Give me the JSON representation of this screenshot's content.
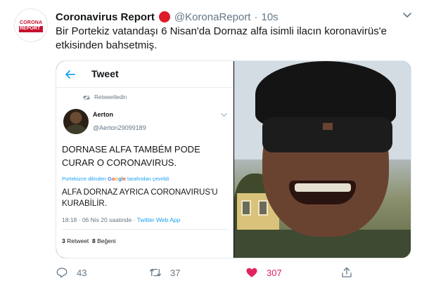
{
  "author": {
    "display_name": "Coronavirus Report",
    "handle": "@KoronaReport",
    "separator": "·",
    "time": "10s",
    "avatar_top": "CORONA",
    "avatar_bottom": "REPORT"
  },
  "tweet_text": "Bir Portekiz vatandaşı 6 Nisan'da Dornaz alfa isimli ilacın koronavirüs'e etkisinden bahsetmiş.",
  "embedded": {
    "header_title": "Tweet",
    "retweeted_label": "Retweetledin",
    "author_name": "Aerton",
    "author_handle": "@Aerton29099189",
    "original_text": "DORNASE ALFA TAMBÉM PODE CURAR O CORONAVIRUS.",
    "translated_prefix": "Portekizce dilinden",
    "translated_service": [
      "G",
      "o",
      "o",
      "g",
      "l",
      "e"
    ],
    "translated_suffix": "tarafından çevrildi",
    "translated_text": "ALFA DORNAZ AYRICA CORONAVIRUS'U KURABİLİR.",
    "time_date": "18:18 · 06 Nis 20 saatinde ·",
    "client": "Twitter Web App",
    "retweets_count": "3",
    "retweets_label": "Retweet",
    "likes_count": "8",
    "likes_label": "Beğeni"
  },
  "actions": {
    "reply_count": "43",
    "retweet_count": "37",
    "like_count": "307",
    "like_color": "#e0245e"
  },
  "icons": [
    "reply-icon",
    "retweet-icon",
    "heart-icon",
    "share-icon",
    "chevron-down-icon",
    "back-arrow-icon"
  ]
}
